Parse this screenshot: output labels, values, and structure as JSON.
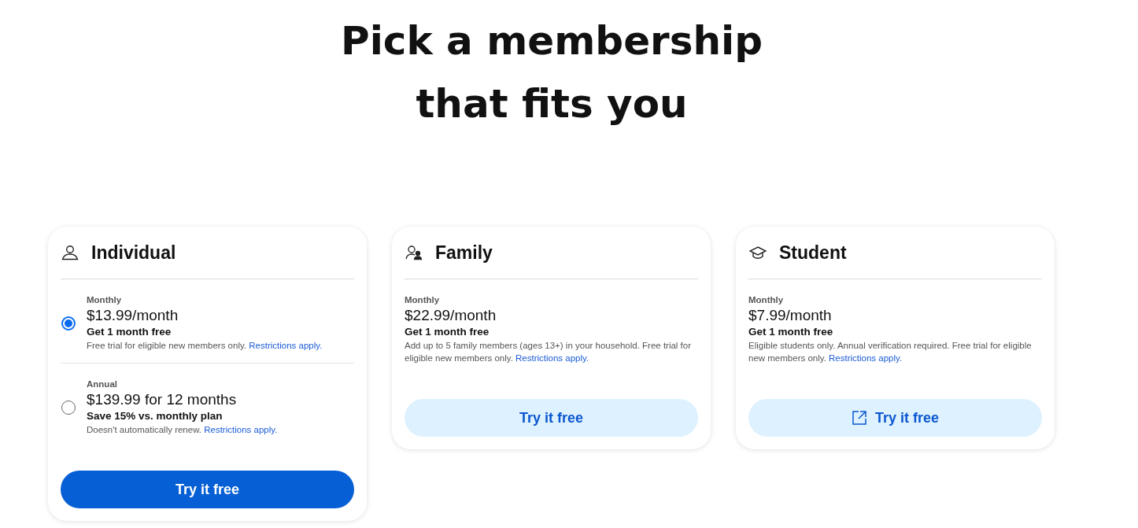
{
  "heading": {
    "lines": [
      "Pick a membership",
      "that fits you"
    ]
  },
  "plans": [
    {
      "title": "Individual",
      "options": [
        {
          "kind": "radio",
          "selected": true,
          "label": "Monthly",
          "price": "$13.99/month",
          "offer": "Get 1 month free",
          "note": "Free trial for eligible new members only.",
          "link": "Restrictions apply."
        },
        {
          "kind": "radio",
          "selected": false,
          "label": "Annual",
          "price": "$139.99 for 12 months",
          "offer": "Save 15% vs. monthly plan",
          "note": "Doesn't automatically renew.",
          "link": "Restrictions apply."
        }
      ],
      "button": {
        "kind": "primary",
        "label": "Try it free",
        "external": false
      }
    },
    {
      "title": "Family",
      "options": [
        {
          "kind": "plain",
          "label": "Monthly",
          "price": "$22.99/month",
          "offer": "Get 1 month free",
          "note": "Add up to 5 family members (ages 13+) in your household. Free trial for eligible new members only.",
          "link": "Restrictions apply."
        }
      ],
      "button": {
        "kind": "secondary",
        "label": "Try it free",
        "external": false
      }
    },
    {
      "title": "Student",
      "options": [
        {
          "kind": "plain",
          "label": "Monthly",
          "price": "$7.99/month",
          "offer": "Get 1 month free",
          "note": "Eligible students only. Annual verification required. Free trial for eligible new members only.",
          "link": "Restrictions apply."
        }
      ],
      "button": {
        "kind": "secondary",
        "label": "Try it free",
        "external": true
      }
    }
  ]
}
